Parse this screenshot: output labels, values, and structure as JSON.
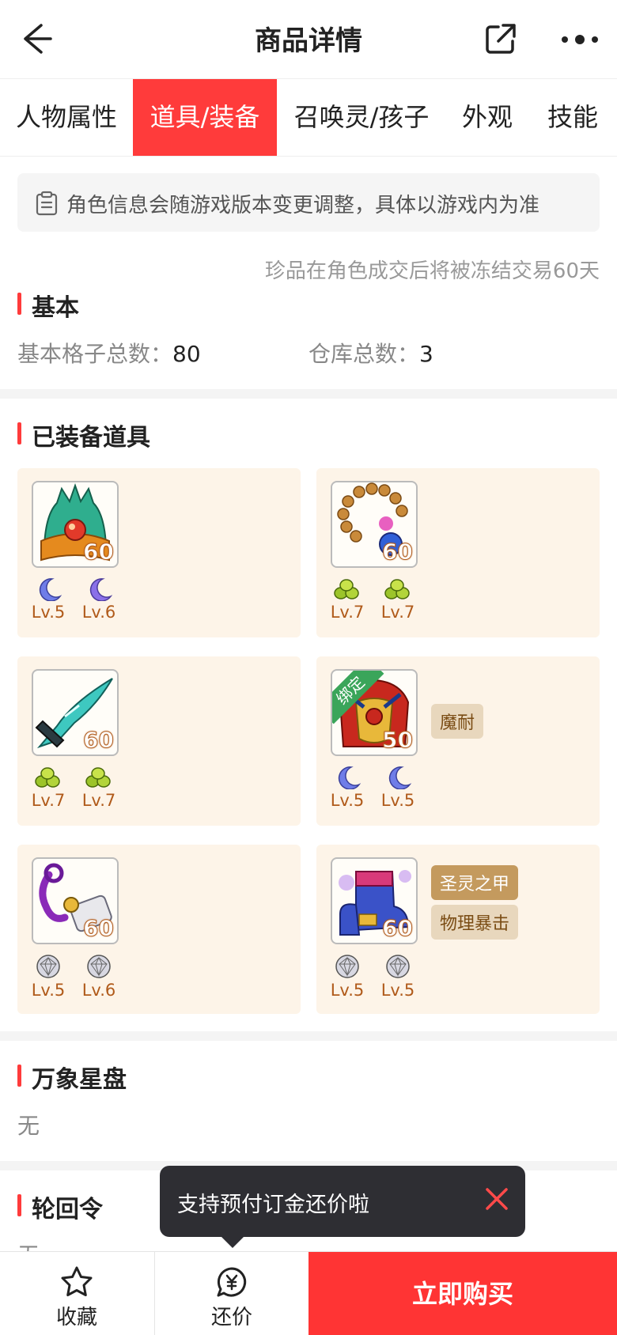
{
  "header": {
    "title": "商品详情",
    "back_icon": "back-arrow-icon",
    "share_icon": "share-icon",
    "more_icon": "more-icon"
  },
  "tabs": [
    {
      "label": "人物属性",
      "active": false
    },
    {
      "label": "道具/装备",
      "active": true
    },
    {
      "label": "召唤灵/孩子",
      "active": false
    },
    {
      "label": "外观",
      "active": false
    },
    {
      "label": "技能",
      "active": false
    }
  ],
  "notice": {
    "text": "角色信息会随游戏版本变更调整，具体以游戏内为准"
  },
  "freeze_note": "珍品在角色成交后将被冻结交易60天",
  "basic": {
    "title": "基本",
    "grid_label": "基本格子总数：",
    "grid_value": "80",
    "warehouse_label": "仓库总数：",
    "warehouse_value": "3"
  },
  "equipped": {
    "title": "已装备道具",
    "items": [
      {
        "icon": "helmet-icon",
        "level": "60",
        "gems": [
          {
            "icon": "moon-gem-icon",
            "level": "Lv.5"
          },
          {
            "icon": "moon-gem-icon",
            "level": "Lv.6"
          }
        ],
        "tags": []
      },
      {
        "icon": "necklace-icon",
        "level": "60",
        "gems": [
          {
            "icon": "green-gem-icon",
            "level": "Lv.7"
          },
          {
            "icon": "green-gem-icon",
            "level": "Lv.7"
          }
        ],
        "tags": []
      },
      {
        "icon": "weapon-icon",
        "level": "60",
        "gems": [
          {
            "icon": "green-gem-icon",
            "level": "Lv.7"
          },
          {
            "icon": "green-gem-icon",
            "level": "Lv.7"
          }
        ],
        "tags": []
      },
      {
        "icon": "armor-icon",
        "level": "50",
        "bound": "绑定",
        "gems": [
          {
            "icon": "moon-gem-icon",
            "level": "Lv.5"
          },
          {
            "icon": "moon-gem-icon",
            "level": "Lv.5"
          }
        ],
        "tags": [
          "魔耐"
        ]
      },
      {
        "icon": "belt-icon",
        "level": "60",
        "gems": [
          {
            "icon": "diamond-gem-icon",
            "level": "Lv.5"
          },
          {
            "icon": "diamond-gem-icon",
            "level": "Lv.6"
          }
        ],
        "tags": []
      },
      {
        "icon": "boots-icon",
        "level": "60",
        "gems": [
          {
            "icon": "diamond-gem-icon",
            "level": "Lv.5"
          },
          {
            "icon": "diamond-gem-icon",
            "level": "Lv.5"
          }
        ],
        "tags": [
          "圣灵之甲",
          "物理暴击"
        ]
      }
    ]
  },
  "star_disk": {
    "title": "万象星盘",
    "value": "无"
  },
  "reincarnation": {
    "title": "轮回令",
    "value": "无"
  },
  "toast": {
    "text": "支持预付订金还价啦",
    "close_icon": "close-icon"
  },
  "bottom": {
    "favorite_label": "收藏",
    "bargain_label": "还价",
    "buy_label": "立即购买"
  },
  "colors": {
    "accent": "#ff3b3b",
    "card_bg": "#fdf4e8",
    "gem_level": "#b05a1a"
  }
}
